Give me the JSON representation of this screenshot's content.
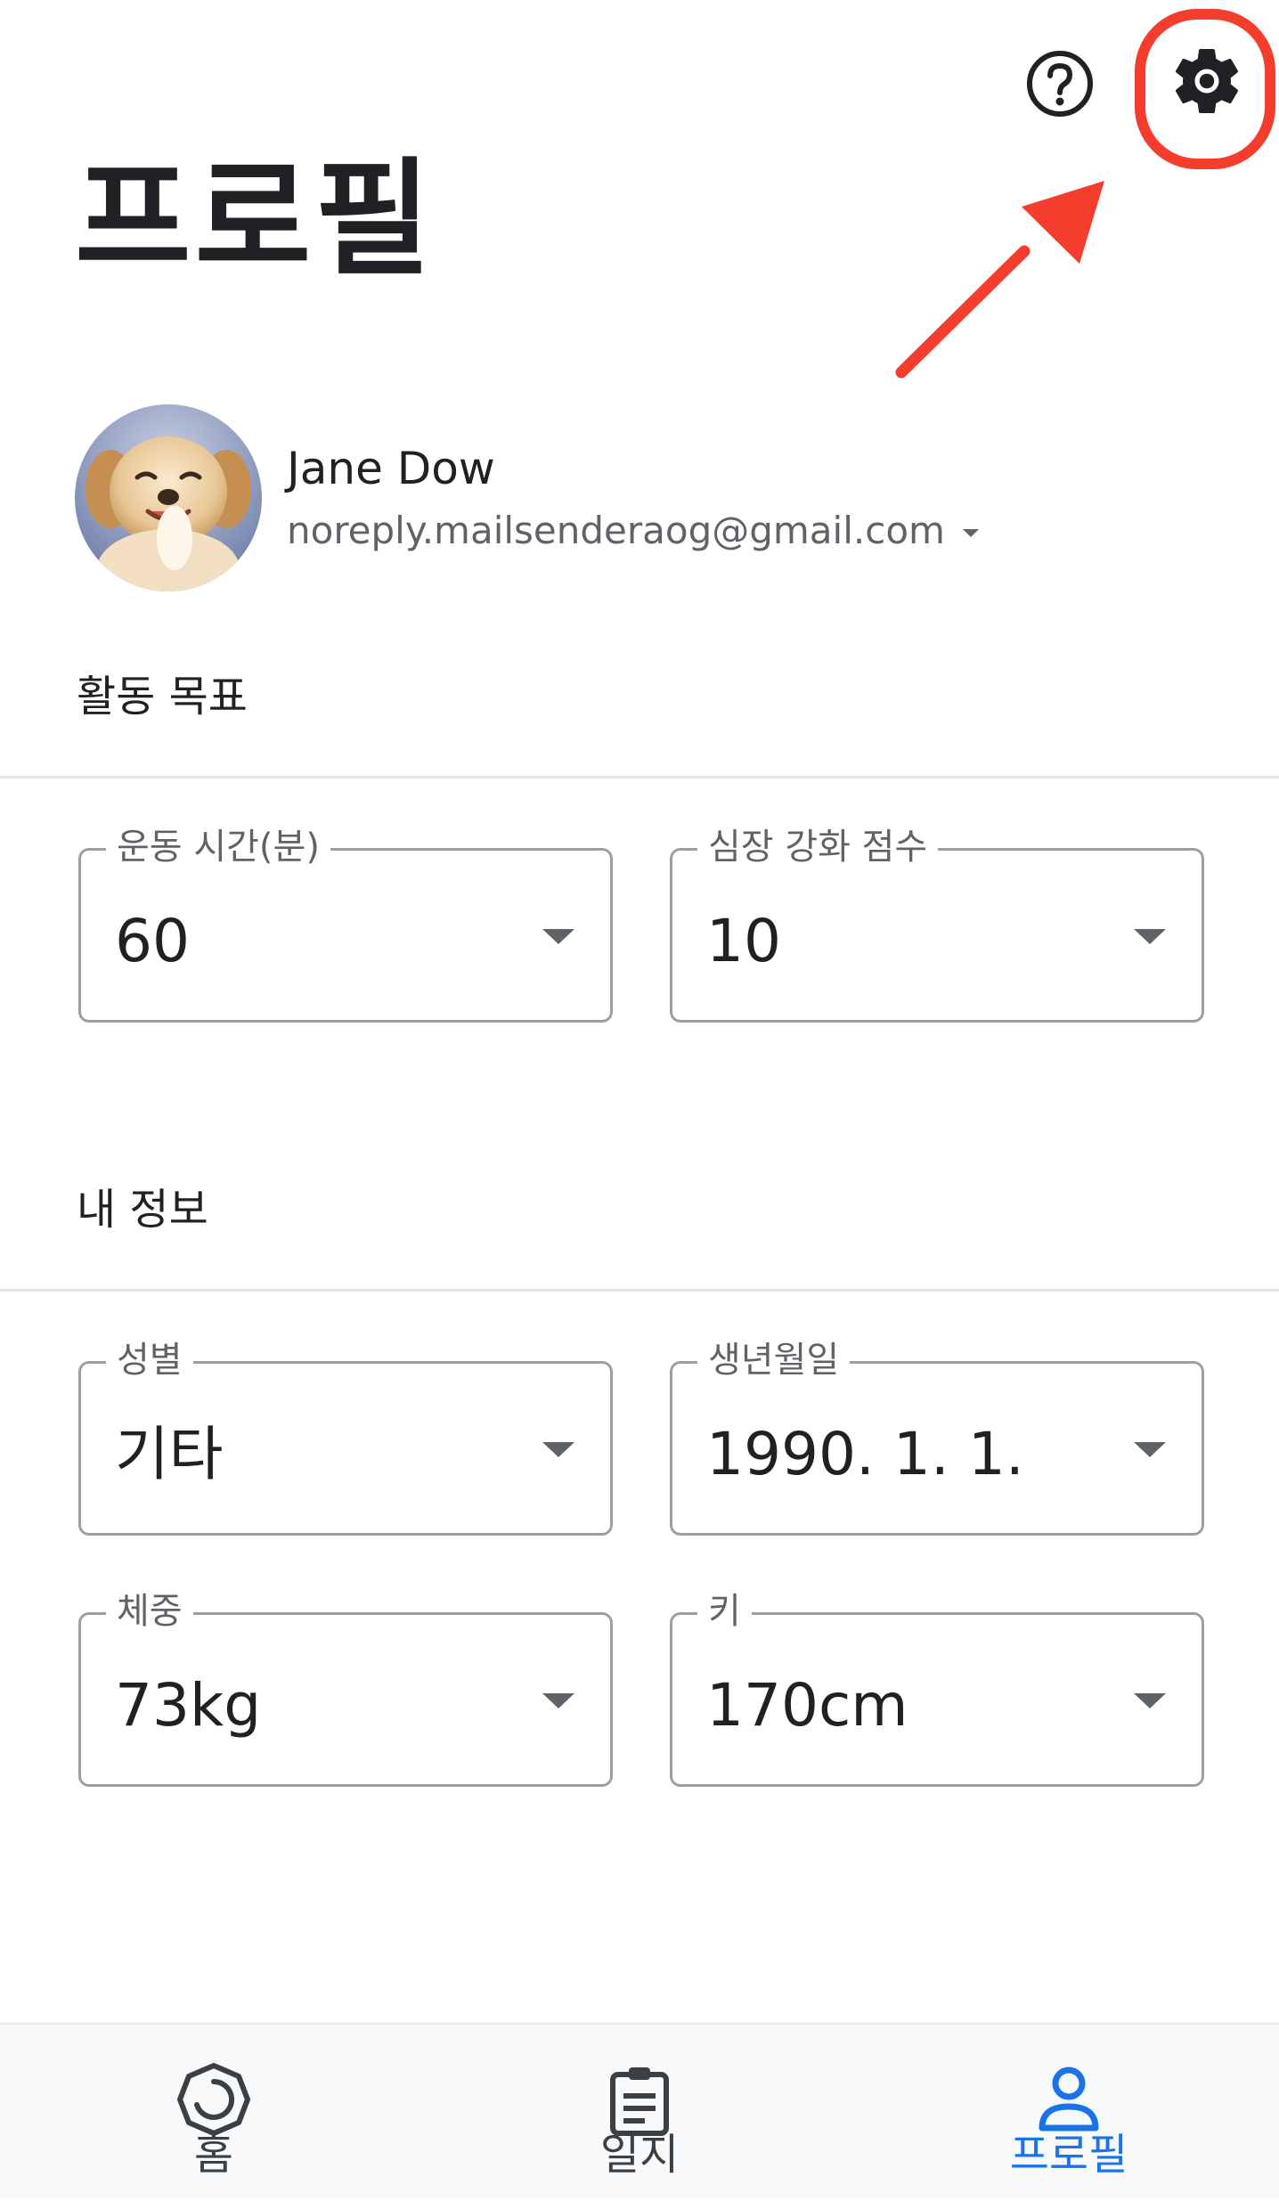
{
  "header": {
    "title": "프로필",
    "help_icon": "help-circle-icon",
    "settings_icon": "gear-icon"
  },
  "annotation": {
    "color": "#f53d2d"
  },
  "account": {
    "name": "Jane Dow",
    "email": "noreply.mailsenderaog@gmail.com"
  },
  "activity_goals": {
    "title": "활동 목표",
    "fields": [
      {
        "label": "운동 시간(분)",
        "value": "60"
      },
      {
        "label": "심장 강화 점수",
        "value": "10"
      }
    ]
  },
  "my_info": {
    "title": "내 정보",
    "fields": [
      {
        "label": "성별",
        "value": "기타"
      },
      {
        "label": "생년월일",
        "value": "1990. 1. 1."
      },
      {
        "label": "체중",
        "value": "73kg"
      },
      {
        "label": "키",
        "value": "170cm"
      }
    ]
  },
  "bottom_nav": {
    "items": [
      {
        "label": "홈",
        "icon": "home-ring-icon",
        "active": false
      },
      {
        "label": "일지",
        "icon": "journal-clipboard-icon",
        "active": false
      },
      {
        "label": "프로필",
        "icon": "profile-person-icon",
        "active": true
      }
    ],
    "active_color": "#1a73e8",
    "inactive_color": "#3c4043"
  }
}
